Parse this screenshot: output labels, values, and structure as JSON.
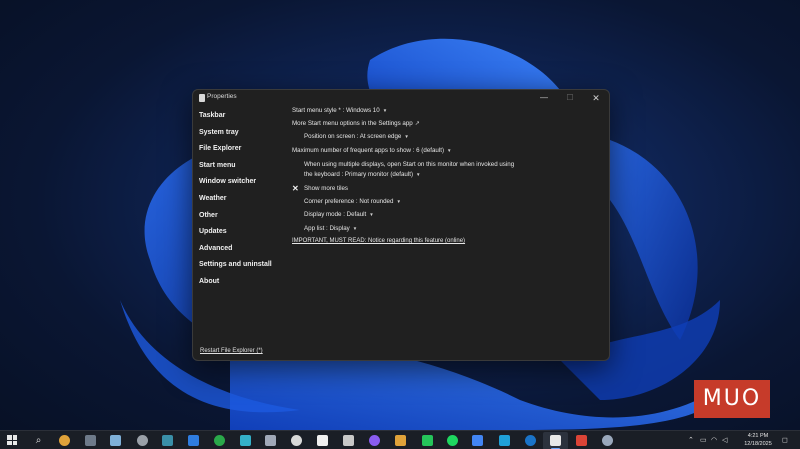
{
  "window": {
    "title": "Properties",
    "controls": {
      "minimize": "—",
      "maximize": "☐",
      "close": "✕"
    }
  },
  "sidebar": {
    "items": [
      {
        "label": "Taskbar"
      },
      {
        "label": "System tray"
      },
      {
        "label": "File Explorer"
      },
      {
        "label": "Start menu"
      },
      {
        "label": "Window switcher"
      },
      {
        "label": "Weather"
      },
      {
        "label": "Other"
      },
      {
        "label": "Updates"
      },
      {
        "label": "Advanced"
      },
      {
        "label": "Settings and uninstall"
      },
      {
        "label": "About"
      }
    ],
    "restart_link": "Restart File Explorer (*)"
  },
  "settings": {
    "start_menu_style": "Start menu style * : Windows 10",
    "more_options_link": "More Start menu options in the Settings app",
    "position_on_screen": "Position on screen : At screen edge",
    "max_frequent_apps": "Maximum number of frequent apps to show : 6 (default)",
    "multi_display_line1": "When using multiple displays, open Start on this monitor when invoked using",
    "multi_display_line2": "the keyboard : Primary monitor (default)",
    "show_more_tiles": "Show more tiles",
    "corner_preference": "Corner preference : Not rounded",
    "display_mode": "Display mode : Default",
    "app_list": "App list : Display",
    "important_link": "IMPORTANT, MUST READ: Notice regarding this feature (online)"
  },
  "watermark": "MUO",
  "taskbar": {
    "icons": [
      {
        "name": "chrome-icon",
        "color": "#e0a23a"
      },
      {
        "name": "calculator-icon",
        "color": "#6e7a8a"
      },
      {
        "name": "snip-icon",
        "color": "#7fb0d8"
      },
      {
        "name": "usb-icon",
        "color": "#9aa0a8"
      },
      {
        "name": "photos-icon",
        "color": "#3a8fa8"
      },
      {
        "name": "app-store-icon",
        "color": "#2f7de0"
      },
      {
        "name": "green-app-icon",
        "color": "#2aa84a"
      },
      {
        "name": "vpn-icon",
        "color": "#34b0c8"
      },
      {
        "name": "edit-icon",
        "color": "#a0a8b8"
      },
      {
        "name": "obs-icon",
        "color": "#d8d8d8"
      },
      {
        "name": "notion-icon",
        "color": "#f0f0f0"
      },
      {
        "name": "paste-icon",
        "color": "#c8c8c8"
      },
      {
        "name": "proton-icon",
        "color": "#8a5cf0"
      },
      {
        "name": "slack-icon",
        "color": "#e0a23a"
      },
      {
        "name": "whatsapp-icon",
        "color": "#25c45a"
      },
      {
        "name": "spotify-icon",
        "color": "#1ed760"
      },
      {
        "name": "chrome-icon-2",
        "color": "#4285f4"
      },
      {
        "name": "edge-icon",
        "color": "#1fa0d8"
      },
      {
        "name": "outlook-icon",
        "color": "#1a73c8"
      },
      {
        "name": "properties-app-icon",
        "color": "#e8e8e8"
      },
      {
        "name": "chrome-icon-3",
        "color": "#db4437"
      },
      {
        "name": "settings-icon",
        "color": "#9aa8bc"
      }
    ],
    "clock_time": "4:21 PM",
    "clock_date": "12/18/2025"
  }
}
